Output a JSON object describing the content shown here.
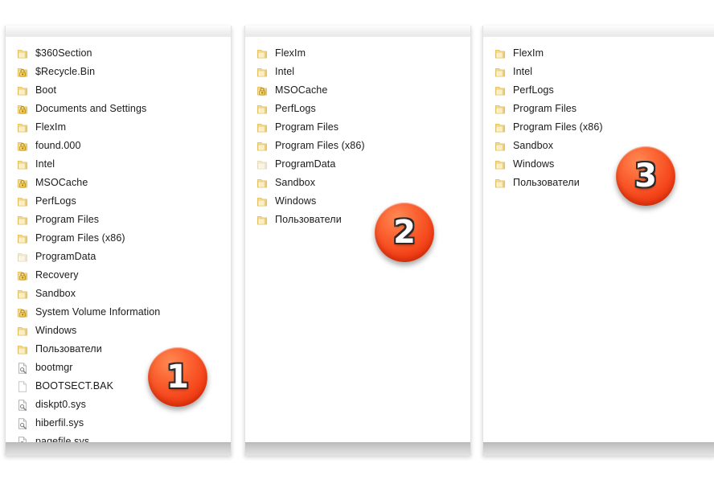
{
  "panels": [
    {
      "id": "panel-1",
      "badge": "1",
      "items": [
        {
          "name": "$360Section",
          "icon": "folder-icon"
        },
        {
          "name": "$Recycle.Bin",
          "icon": "locked-folder-icon"
        },
        {
          "name": "Boot",
          "icon": "folder-icon"
        },
        {
          "name": "Documents and Settings",
          "icon": "locked-folder-icon"
        },
        {
          "name": "FlexIm",
          "icon": "folder-icon"
        },
        {
          "name": "found.000",
          "icon": "locked-folder-icon"
        },
        {
          "name": "Intel",
          "icon": "folder-icon"
        },
        {
          "name": "MSOCache",
          "icon": "locked-folder-icon"
        },
        {
          "name": "PerfLogs",
          "icon": "folder-icon"
        },
        {
          "name": "Program Files",
          "icon": "folder-icon"
        },
        {
          "name": "Program Files (x86)",
          "icon": "folder-icon"
        },
        {
          "name": "ProgramData",
          "icon": "folder-faded-icon"
        },
        {
          "name": "Recovery",
          "icon": "locked-folder-icon"
        },
        {
          "name": "Sandbox",
          "icon": "folder-icon"
        },
        {
          "name": "System Volume Information",
          "icon": "locked-folder-icon"
        },
        {
          "name": "Windows",
          "icon": "folder-icon"
        },
        {
          "name": "Пользователи",
          "icon": "folder-icon"
        },
        {
          "name": "bootmgr",
          "icon": "system-file-icon"
        },
        {
          "name": "BOOTSECT.BAK",
          "icon": "blank-file-icon"
        },
        {
          "name": "diskpt0.sys",
          "icon": "system-file-icon"
        },
        {
          "name": "hiberfil.sys",
          "icon": "system-file-icon"
        },
        {
          "name": "pagefile.sys",
          "icon": "system-file-icon"
        }
      ]
    },
    {
      "id": "panel-2",
      "badge": "2",
      "items": [
        {
          "name": "FlexIm",
          "icon": "folder-icon"
        },
        {
          "name": "Intel",
          "icon": "folder-icon"
        },
        {
          "name": "MSOCache",
          "icon": "locked-folder-icon"
        },
        {
          "name": "PerfLogs",
          "icon": "folder-icon"
        },
        {
          "name": "Program Files",
          "icon": "folder-icon"
        },
        {
          "name": "Program Files (x86)",
          "icon": "folder-icon"
        },
        {
          "name": "ProgramData",
          "icon": "folder-faded-icon"
        },
        {
          "name": "Sandbox",
          "icon": "folder-icon"
        },
        {
          "name": "Windows",
          "icon": "folder-icon"
        },
        {
          "name": "Пользователи",
          "icon": "folder-icon"
        }
      ]
    },
    {
      "id": "panel-3",
      "badge": "3",
      "items": [
        {
          "name": "FlexIm",
          "icon": "folder-icon"
        },
        {
          "name": "Intel",
          "icon": "folder-icon"
        },
        {
          "name": "PerfLogs",
          "icon": "folder-icon"
        },
        {
          "name": "Program Files",
          "icon": "folder-icon"
        },
        {
          "name": "Program Files (x86)",
          "icon": "folder-icon"
        },
        {
          "name": "Sandbox",
          "icon": "folder-icon"
        },
        {
          "name": "Windows",
          "icon": "folder-icon"
        },
        {
          "name": "Пользователи",
          "icon": "folder-icon"
        }
      ]
    }
  ],
  "colors": {
    "badge_highlight": "#ff8a55",
    "badge_base": "#f4441a",
    "badge_shadow": "#ea3007",
    "folder_yellow": "#f2d57e",
    "panel_background": "#ffffff",
    "text": "#1a1a1a"
  }
}
